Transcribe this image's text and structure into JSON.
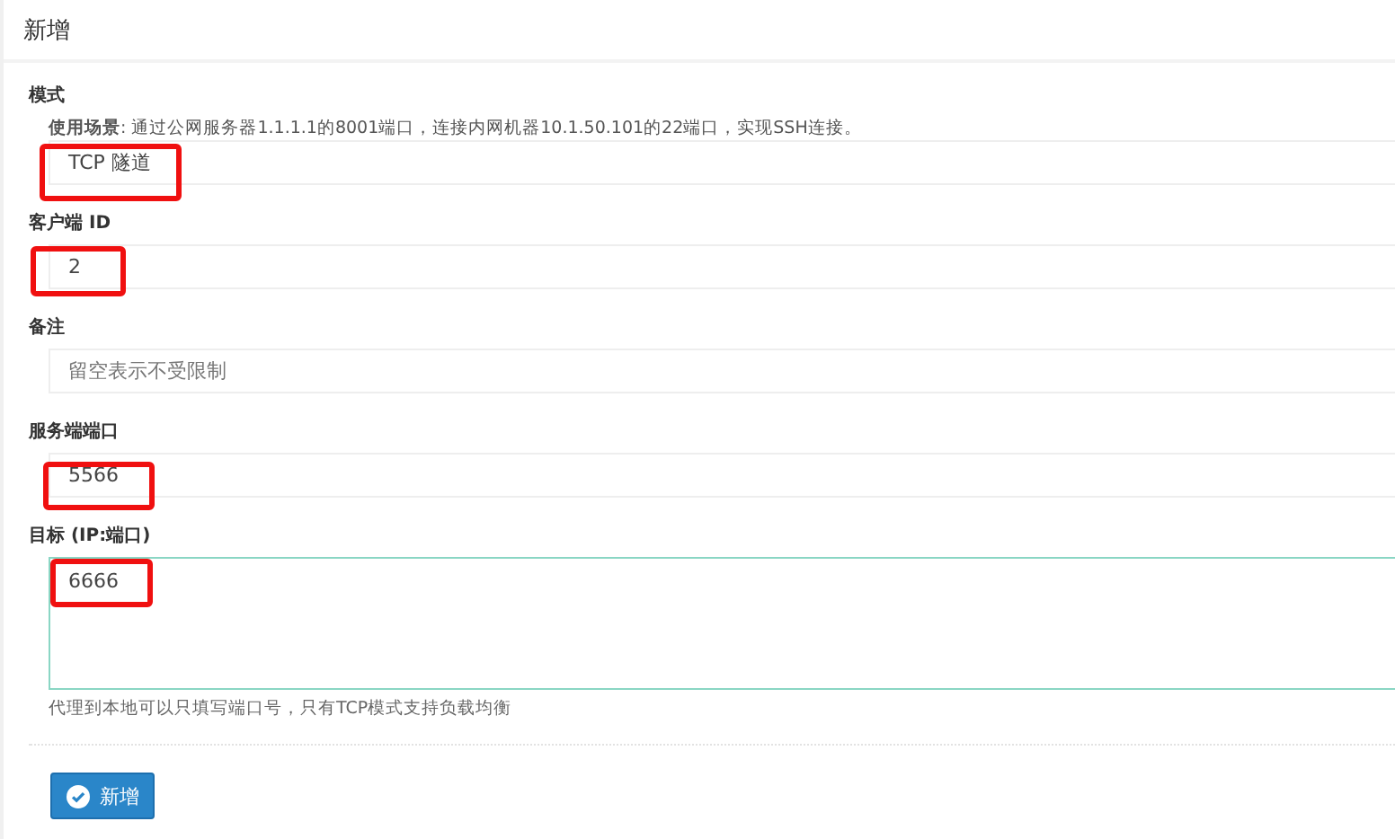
{
  "panel": {
    "title": "新增"
  },
  "fields": [
    {
      "kind": "select",
      "label": "模式",
      "note_label": "使用场景",
      "note": ": 通过公网服务器1.1.1.1的8001端口，连接内网机器10.1.50.101的22端口，实现SSH连接。",
      "value": "TCP 隧道",
      "highlighted": true
    },
    {
      "kind": "input",
      "label": "客户端 ID",
      "value": "2",
      "highlighted": true
    },
    {
      "kind": "input",
      "label": "备注",
      "placeholder": "留空表示不受限制",
      "highlighted": false
    },
    {
      "kind": "input",
      "label": "服务端端口",
      "value": "5566",
      "highlighted": true
    },
    {
      "kind": "textarea",
      "label": "目标 (IP:端口)",
      "value": "6666",
      "highlighted": true,
      "help": "代理到本地可以只填写端口号，只有TCP模式支持负载均衡"
    }
  ],
  "submit": {
    "label": "新增"
  }
}
